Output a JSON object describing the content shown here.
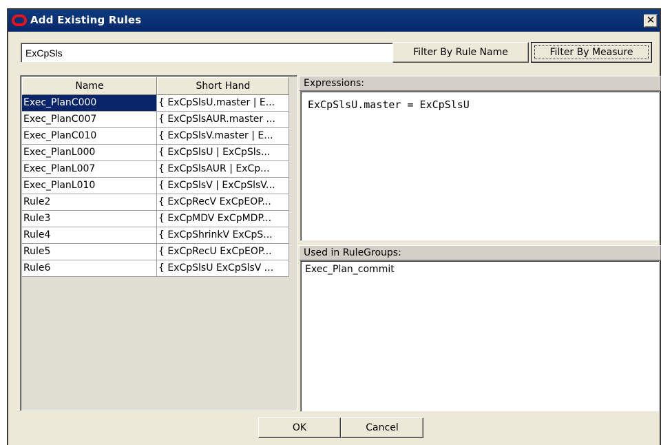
{
  "window": {
    "title": "Add Existing Rules",
    "close_label": "✕"
  },
  "filter": {
    "value": "ExCpSls",
    "by_rule_name_label": "Filter By Rule Name",
    "by_measure_label": "Filter By Measure"
  },
  "table": {
    "columns": [
      "Name",
      "Short Hand"
    ],
    "rows": [
      {
        "name": "Exec_PlanC000",
        "short": "{ ExCpSlsU.master | E..."
      },
      {
        "name": "Exec_PlanC007",
        "short": "{ ExCpSlsAUR.master ..."
      },
      {
        "name": "Exec_PlanC010",
        "short": "{ ExCpSlsV.master | E..."
      },
      {
        "name": "Exec_PlanL000",
        "short": "{ ExCpSlsU | ExCpSls..."
      },
      {
        "name": "Exec_PlanL007",
        "short": "{ ExCpSlsAUR | ExCp..."
      },
      {
        "name": "Exec_PlanL010",
        "short": "{ ExCpSlsV | ExCpSlsV..."
      },
      {
        "name": "Rule2",
        "short": "{ ExCpRecV ExCpEOP..."
      },
      {
        "name": "Rule3",
        "short": "{ ExCpMDV ExCpMDP..."
      },
      {
        "name": "Rule4",
        "short": "{ ExCpShrinkV ExCpS..."
      },
      {
        "name": "Rule5",
        "short": "{ ExCpRecU ExCpEOP..."
      },
      {
        "name": "Rule6",
        "short": "{ ExCpSlsU ExCpSlsV ..."
      }
    ],
    "selected_index": 0
  },
  "expressions": {
    "header": "Expressions:",
    "text": "ExCpSlsU.master = ExCpSlsU"
  },
  "used_in": {
    "header": "Used in RuleGroups:",
    "text": "Exec_Plan_commit"
  },
  "footer": {
    "ok_label": "OK",
    "cancel_label": "Cancel"
  },
  "colors": {
    "titlebar": "#0a246a",
    "selection": "#0a246a",
    "dialog_bg": "#ece9d8",
    "icon_red": "#e4141b"
  }
}
